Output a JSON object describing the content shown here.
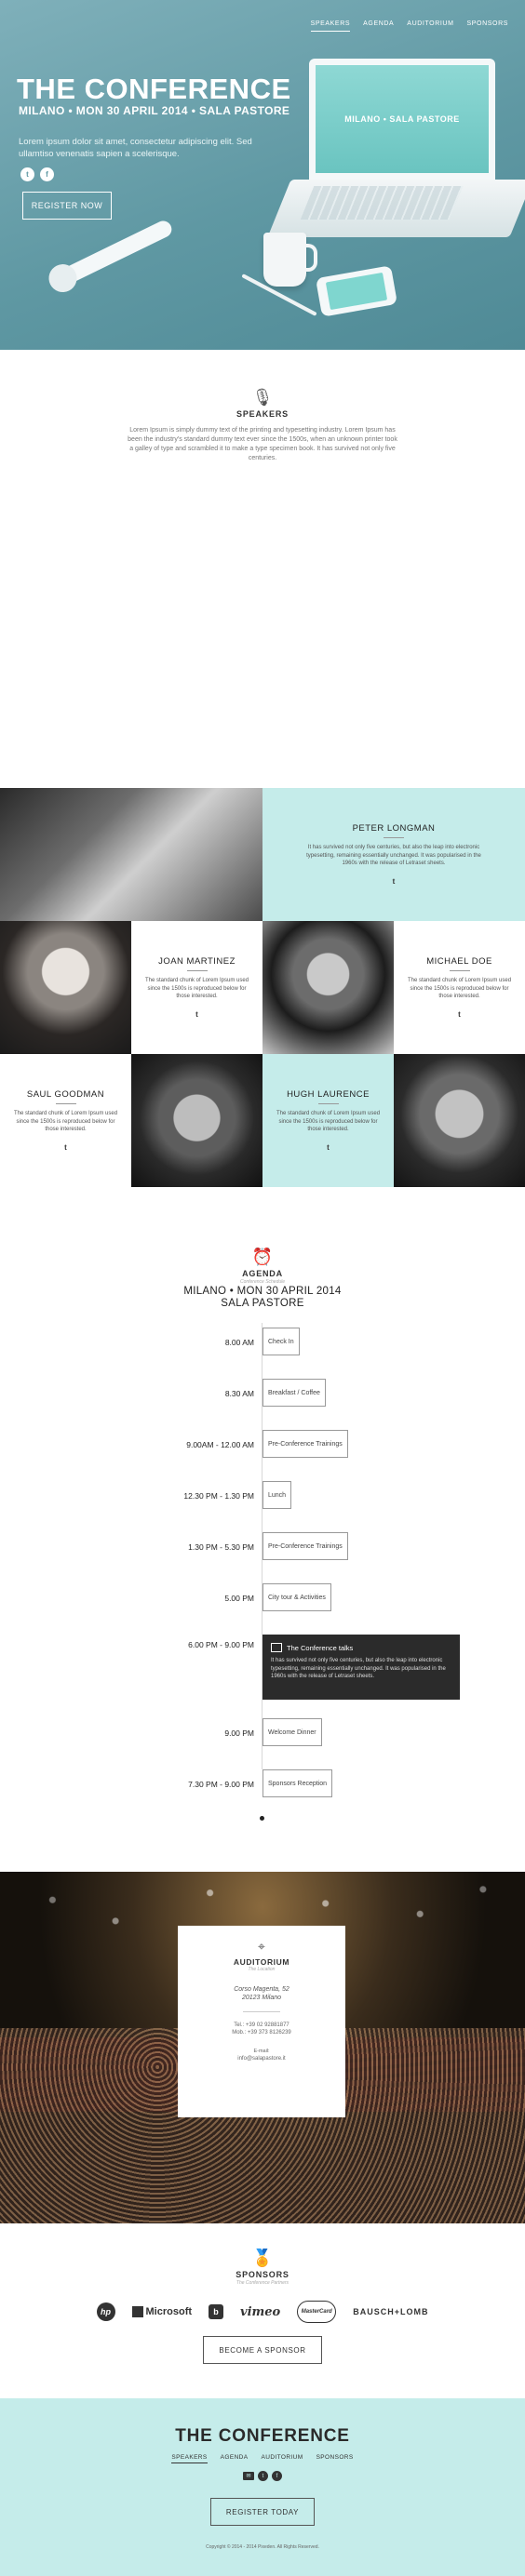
{
  "nav": {
    "items": [
      {
        "label": "SPEAKERS"
      },
      {
        "label": "AGENDA"
      },
      {
        "label": "AUDITORIUM"
      },
      {
        "label": "SPONSORS"
      }
    ]
  },
  "hero": {
    "title": "THE CONFERENCE",
    "subtitle": "MILANO • MON 30 APRIL 2014 • SALA PASTORE",
    "lead": "Lorem ipsum dolor sit amet, consectetur adipiscing elit. Sed ullamtiso venenatis sapien a scelerisque.",
    "social": [
      "t",
      "f"
    ],
    "register_label": "REGISTER NOW",
    "screen_text": "MILANO • SALA PASTORE"
  },
  "speakers": {
    "heading": "SPEAKERS",
    "intro": "Lorem Ipsum is simply dummy text of the printing and typesetting industry. Lorem Ipsum has been the industry's standard dummy text ever since the 1500s, when an unknown printer took a galley of type and scrambled it to make a type specimen book. It has survived not only five centuries.",
    "list": [
      {
        "name": "PETER LONGMAN",
        "bio": "It has survived not only five centuries, but also the leap into electronic typesetting, remaining essentially unchanged. It was popularised in the 1960s with the release of Letraset sheets.",
        "twitter": "t"
      },
      {
        "name": "JOAN MARTINEZ",
        "bio": "The standard chunk of Lorem Ipsum used since the 1500s is reproduced below for those interested.",
        "twitter": "t"
      },
      {
        "name": "MICHAEL DOE",
        "bio": "The standard chunk of Lorem Ipsum used since the 1500s is reproduced below for those interested.",
        "twitter": "t"
      },
      {
        "name": "SAUL GOODMAN",
        "bio": "The standard chunk of Lorem Ipsum used since the 1500s is reproduced below for those interested.",
        "twitter": "t"
      },
      {
        "name": "HUGH LAURENCE",
        "bio": "The standard chunk of Lorem Ipsum used since the 1500s is reproduced below for those interested.",
        "twitter": "t"
      }
    ]
  },
  "agenda": {
    "heading": "AGENDA",
    "tagline": "Conference Schedule",
    "title_line1": "MILANO • MON 30 APRIL 2014",
    "title_line2": "SALA PASTORE",
    "events": [
      {
        "time": "8.00 AM",
        "label": "Check In"
      },
      {
        "time": "8.30 AM",
        "label": "Breakfast / Coffee"
      },
      {
        "time": "9.00AM - 12.00 AM",
        "label": "Pre-Conference Trainings"
      },
      {
        "time": "12.30 PM - 1.30 PM",
        "label": "Lunch"
      },
      {
        "time": "1.30 PM - 5.30 PM",
        "label": "Pre-Conference Trainings"
      },
      {
        "time": "5.00 PM",
        "label": "City tour & Activities"
      },
      {
        "time": "6.00 PM - 9.00 PM",
        "label": "The Conference talks",
        "desc": "It has survived not only five centuries, but also the leap into electronic typesetting, remaining essentially unchanged. It was popularised in the 1960s with the release of Letraset sheets."
      },
      {
        "time": "9.00 PM",
        "label": "Welcome Dinner"
      },
      {
        "time": "7.30 PM - 9.00 PM",
        "label": "Sponsors Reception"
      }
    ]
  },
  "auditorium": {
    "heading": "AUDITORIUM",
    "tagline": "The Location",
    "address_line1": "Corso Magenta, 52",
    "address_line2": "20123 Milano",
    "tel": "Tel.: +39 02 92881877",
    "mob": "Mob.: +39 373 8126239",
    "email_label": "E-mail:",
    "email": "info@salapastore.it"
  },
  "sponsors": {
    "heading": "SPONSORS",
    "tagline": "The Conference Partners",
    "logos": [
      "hp",
      "Microsoft",
      "b",
      "vimeo",
      "MasterCard",
      "BAUSCH+LOMB"
    ],
    "become_label": "BECOME A SPONSOR"
  },
  "footer": {
    "title": "THE CONFERENCE",
    "register_label": "REGISTER TODAY",
    "copyright": "Copyright © 2014 - 2014 Pixeden. All Rights Reserved."
  },
  "colors": {
    "hero_teal": "#5f98a3",
    "mint": "#c5ecea",
    "dark": "#2b2b2b"
  }
}
